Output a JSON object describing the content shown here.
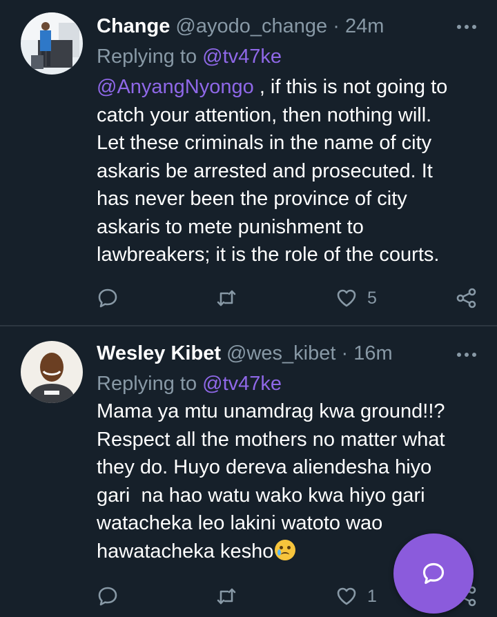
{
  "tweets": [
    {
      "name": "Change",
      "handle": "@ayodo_change",
      "separator": "·",
      "time": "24m",
      "replying_prefix": "Replying to",
      "replying_to": "@tv47ke",
      "mention": "@AnyangNyongo",
      "lines": [
        " , if this is not going to",
        "catch your attention, then nothing will.",
        "Let these criminals in the name of city",
        "askaris be arrested and prosecuted. It",
        "has never been the province of city",
        "askaris to mete punishment to",
        "lawbreakers; it is the role of the courts."
      ],
      "like_count": "5"
    },
    {
      "name": "Wesley Kibet",
      "handle": "@wes_kibet",
      "separator": "·",
      "time": "16m",
      "replying_prefix": "Replying to",
      "replying_to": "@tv47ke",
      "lines": [
        "Mama ya mtu unamdrag kwa ground!!?",
        "Respect all the mothers no matter what",
        "they do. Huyo dereva aliendesha hiyo",
        "gari  na hao watu wako kwa hiyo gari",
        "watacheka leo lakini watoto wao",
        "hawatacheka kesho"
      ],
      "emoji": "crying-face",
      "like_count": "1"
    }
  ],
  "icons": {
    "reply": "speech-bubble-icon",
    "retweet": "retweet-icon",
    "like": "heart-icon",
    "share": "share-icon",
    "more": "more-dots-icon",
    "compose": "compose-reply-icon"
  },
  "colors": {
    "background": "#16202a",
    "text": "#ffffff",
    "muted": "#8899a6",
    "accent": "#8f68e8",
    "fab": "#8b5bdc",
    "divider": "#2d3741"
  }
}
